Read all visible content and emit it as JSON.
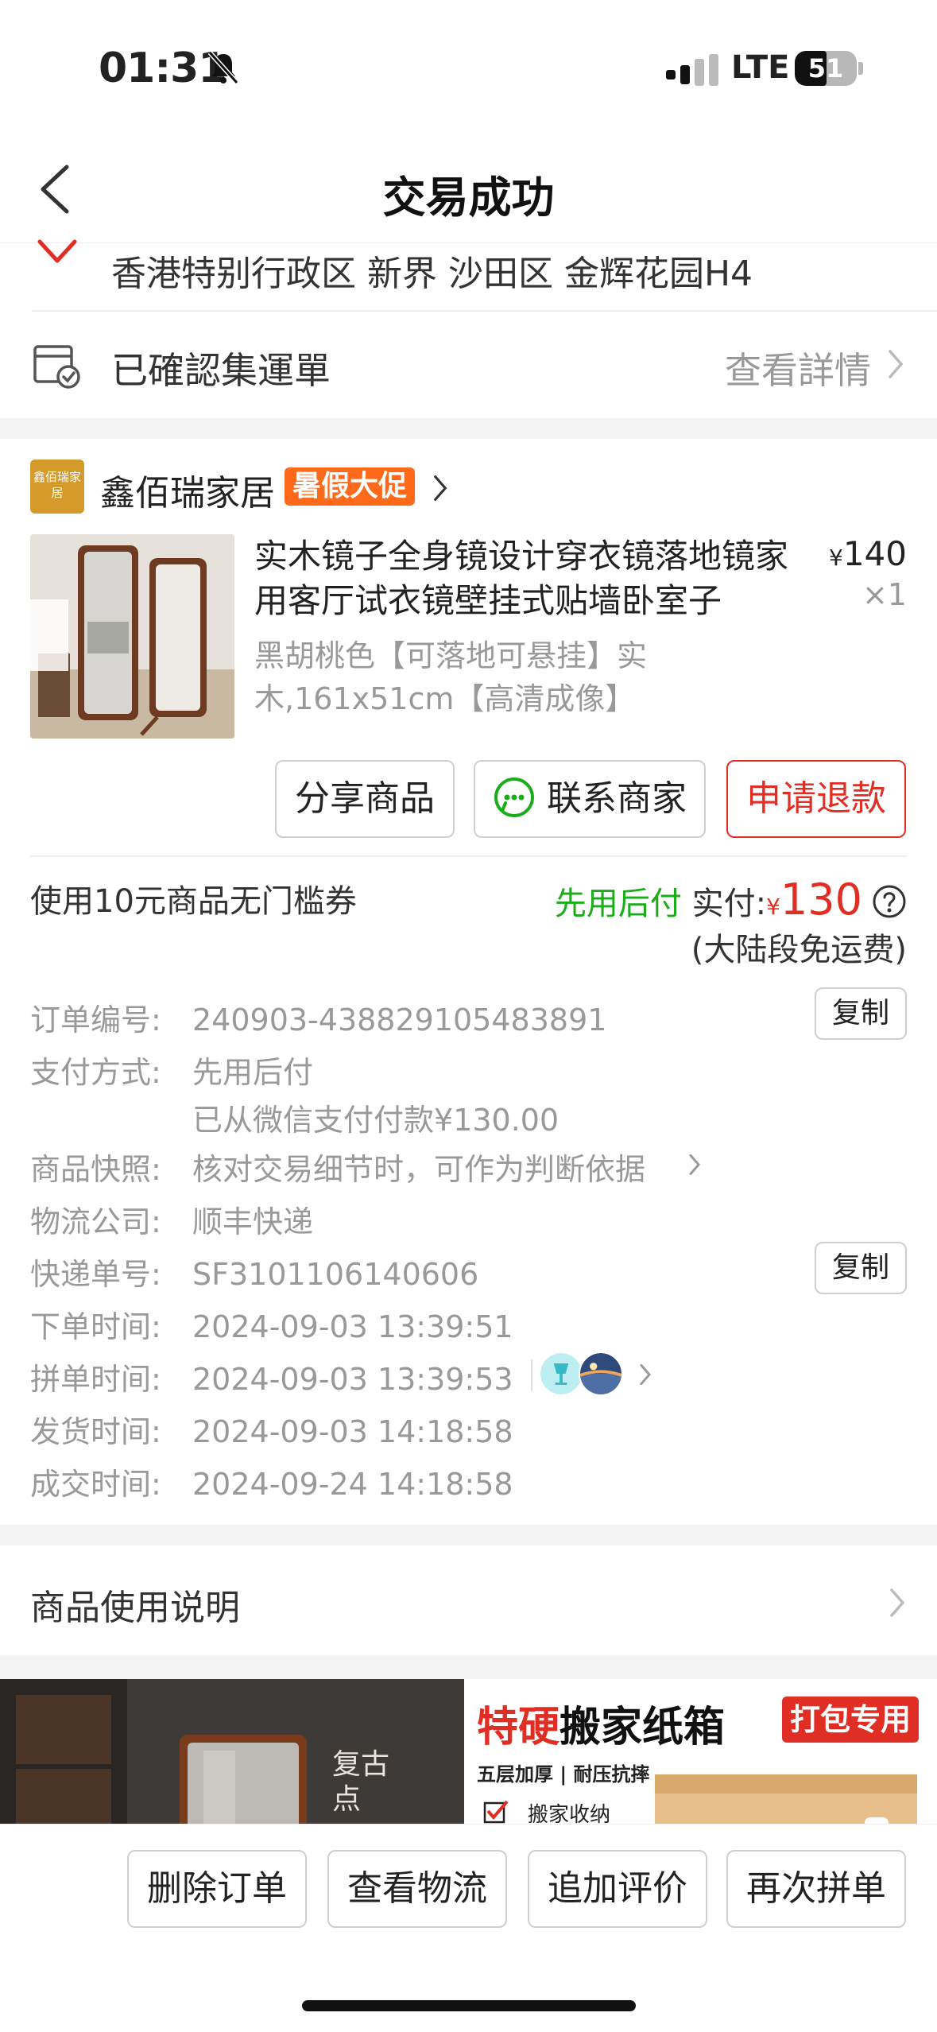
{
  "status_bar": {
    "time": "01:31",
    "network": "LTE",
    "battery": "51",
    "battery_level": 0.51
  },
  "nav": {
    "title": "交易成功"
  },
  "address": {
    "text": "香港特别行政区 新界 沙田区 金辉花园H4"
  },
  "consolidation": {
    "label": "已確認集運單",
    "link": "查看詳情"
  },
  "shop": {
    "logo_text": "鑫佰瑞家居",
    "name": "鑫佰瑞家居",
    "badge": "暑假大促"
  },
  "product": {
    "title": "实木镜子全身镜设计穿衣镜落地镜家用客厅试衣镜壁挂式贴墙卧室子",
    "spec": "黑胡桃色【可落地可悬挂】实木,161x51cm【高清成像】",
    "price_symbol": "¥",
    "price": "140",
    "quantity": "×1"
  },
  "actions": {
    "share": "分享商品",
    "contact": "联系商家",
    "refund": "申请退款"
  },
  "payment": {
    "coupon": "使用10元商品无门槛券",
    "pay_later": "先用后付",
    "paid_label": "实付:",
    "currency": "¥",
    "amount": "130",
    "shipping_note": "(大陆段免运费)"
  },
  "details": {
    "order_no_label": "订单编号:",
    "order_no": "240903-438829105483891",
    "copy": "复制",
    "pay_method_label": "支付方式:",
    "pay_method": "先用后付",
    "pay_method_sub": "已从微信支付付款¥130.00",
    "snapshot_label": "商品快照:",
    "snapshot": "核对交易细节时，可作为判断依据",
    "logistics_label": "物流公司:",
    "logistics": "顺丰快递",
    "tracking_label": "快递单号:",
    "tracking": "SF3101106140606",
    "order_time_label": "下单时间:",
    "order_time": "2024-09-03 13:39:51",
    "group_time_label": "拼单时间:",
    "group_time": "2024-09-03 13:39:53",
    "ship_time_label": "发货时间:",
    "ship_time": "2024-09-03 14:18:58",
    "deal_time_label": "成交时间:",
    "deal_time": "2024-09-24 14:18:58"
  },
  "usage": {
    "label": "商品使用说明"
  },
  "banners": {
    "left_text": "复古点",
    "right_title_red": "特硬",
    "right_title_black": "搬家纸箱",
    "right_tag": "打包专用",
    "right_sub": "五层加厚 | 耐压抗摔",
    "right_item": "搬家收纳"
  },
  "bottom": {
    "delete": "删除订单",
    "logistics": "查看物流",
    "review": "追加评价",
    "rebuy": "再次拼单"
  },
  "colors": {
    "accent_red": "#e02e24",
    "green": "#1aad19",
    "orange": "#ff6a1a"
  }
}
